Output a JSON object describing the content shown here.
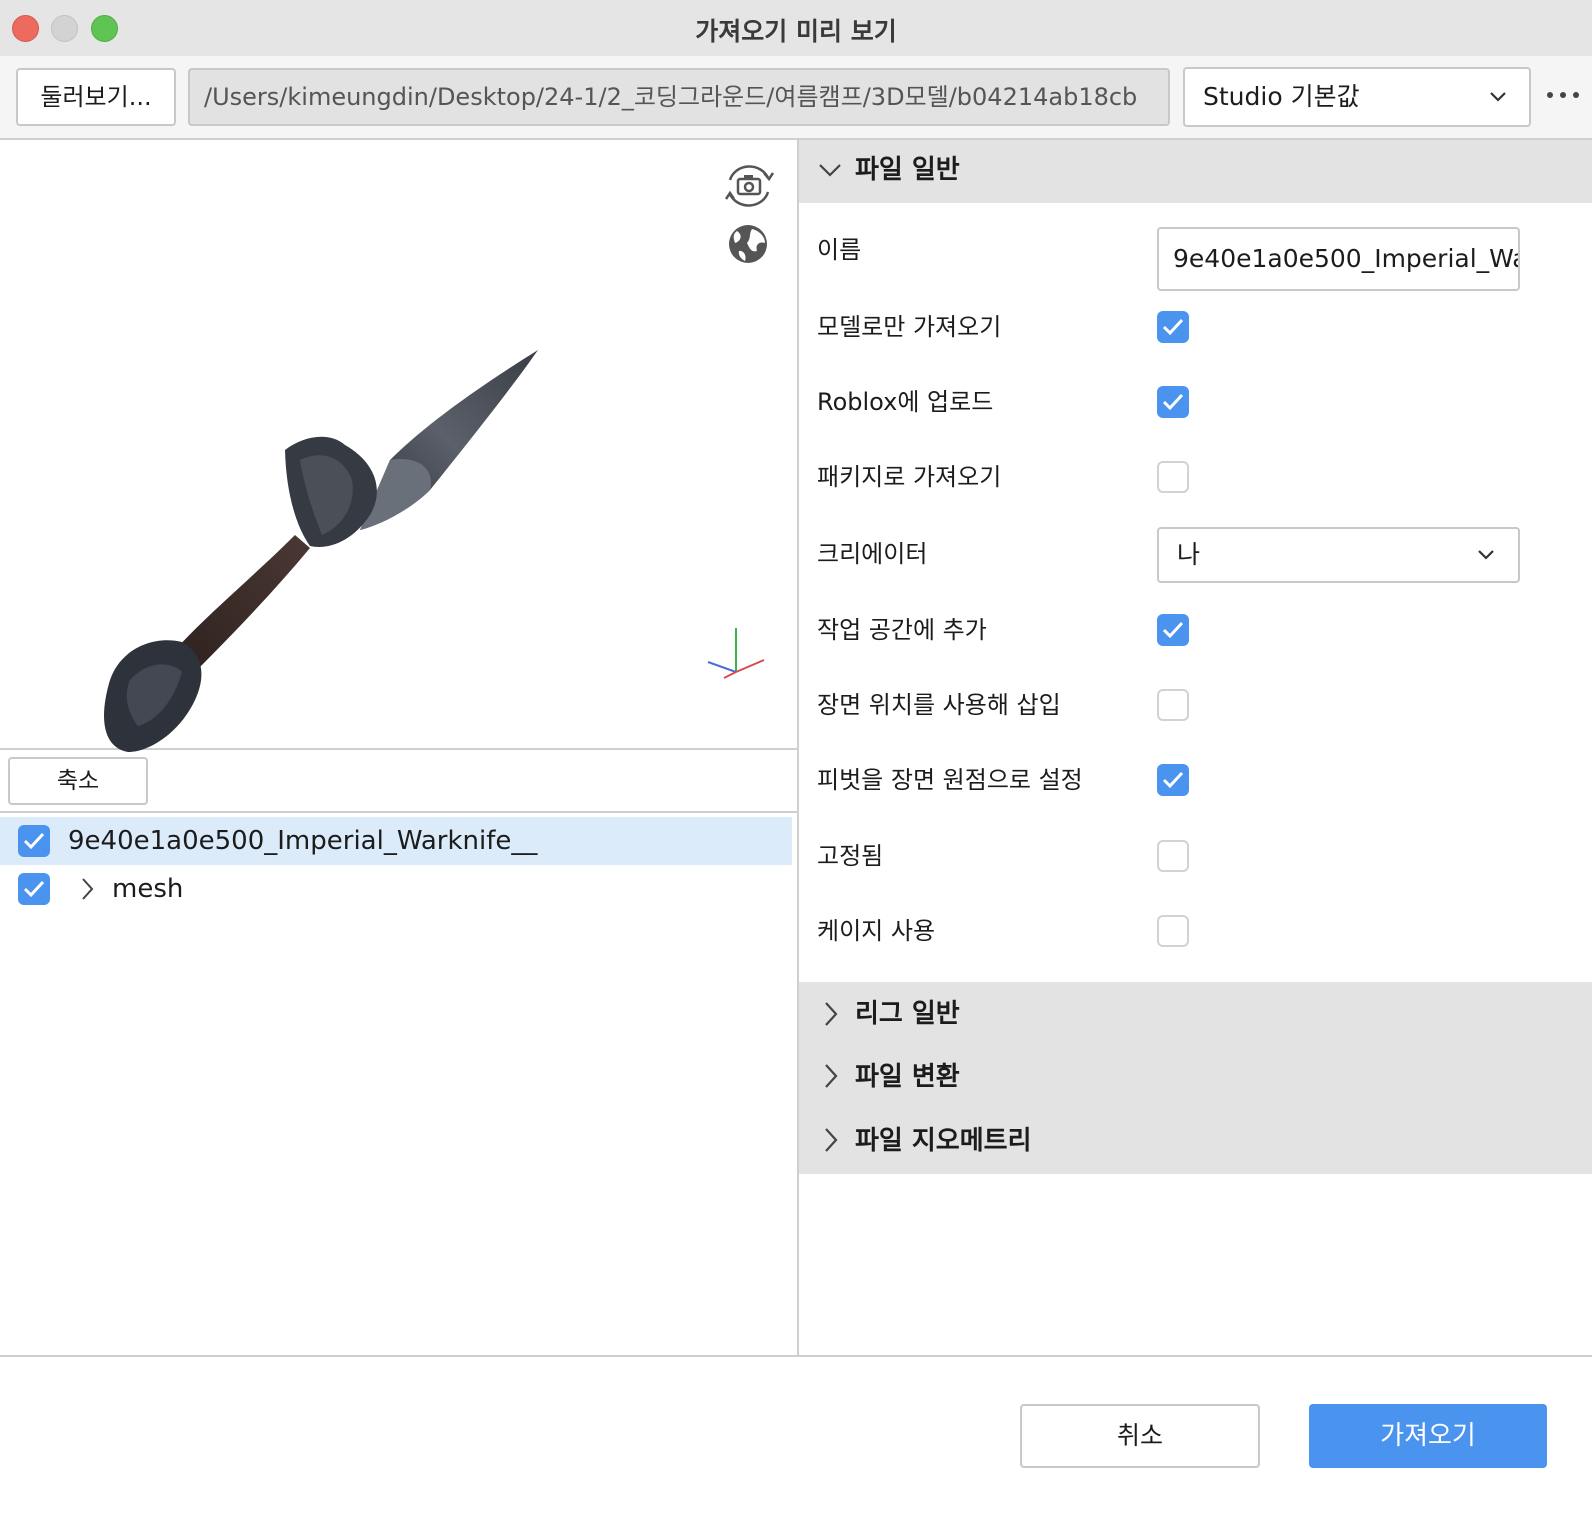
{
  "window": {
    "title": "가져오기 미리 보기"
  },
  "toolbar": {
    "browse_label": "둘러보기...",
    "path": "/Users/kimeungdin/Desktop/24-1/2_코딩그라운드/여름캠프/3D모델/b04214ab18cb",
    "preset": "Studio 기본값"
  },
  "viewport": {
    "camera_icon": "camera-rotate-icon",
    "globe_icon": "globe-icon",
    "axis_icon": "axis-gizmo-icon"
  },
  "tree": {
    "collapse_label": "축소",
    "items": [
      {
        "label": "9e40e1a0e500_Imperial_Warknife__",
        "checked": true,
        "selected": true
      },
      {
        "label": "mesh",
        "checked": true,
        "selected": false
      }
    ]
  },
  "props": {
    "file_general": {
      "title": "파일 일반",
      "name_label": "이름",
      "name_value": "9e40e1a0e500_Imperial_Warknife__",
      "model_only_label": "모델로만 가져오기",
      "model_only": true,
      "upload_label": "Roblox에 업로드",
      "upload": true,
      "package_label": "패키지로 가져오기",
      "package": false,
      "creator_label": "크리에이터",
      "creator_value": "나",
      "add_workspace_label": "작업 공간에 추가",
      "add_workspace": true,
      "scene_position_label": "장면 위치를 사용해 삽입",
      "scene_position": false,
      "pivot_origin_label": "피벗을 장면 원점으로 설정",
      "pivot_origin": true,
      "anchored_label": "고정됨",
      "anchored": false,
      "cage_label": "케이지 사용",
      "cage": false
    },
    "sections": {
      "rig_general": "리그 일반",
      "file_transform": "파일 변환",
      "file_geometry": "파일 지오메트리"
    }
  },
  "footer": {
    "cancel_label": "취소",
    "import_label": "가져오기"
  },
  "colors": {
    "accent": "#4a93ee",
    "selection": "#dcebfa",
    "section_bg": "#e3e3e3"
  }
}
